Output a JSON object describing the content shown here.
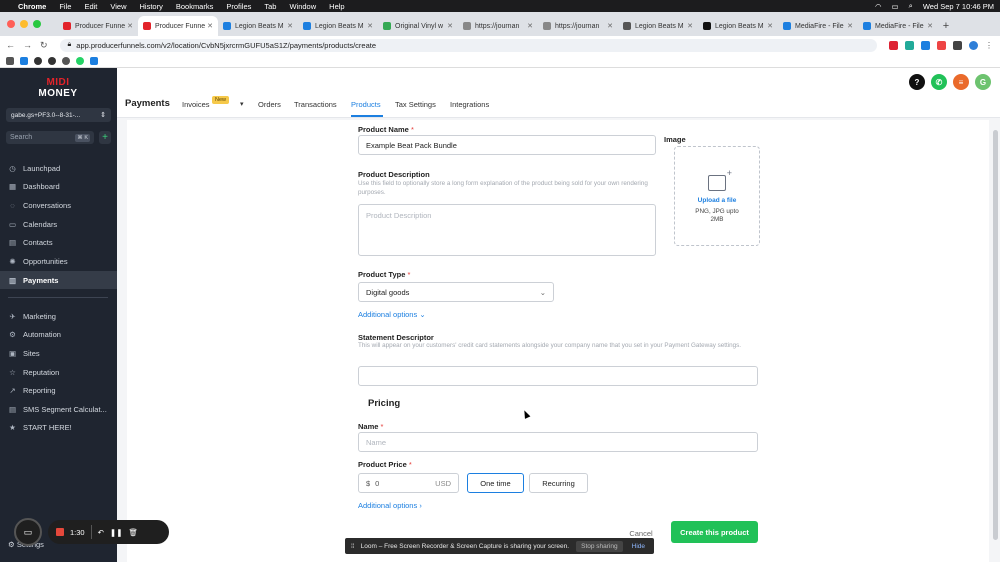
{
  "mac_menubar": {
    "app": "Chrome",
    "menus": [
      "File",
      "Edit",
      "View",
      "History",
      "Bookmarks",
      "Profiles",
      "Tab",
      "Window",
      "Help"
    ],
    "clock": "Wed Sep 7  10:46 PM"
  },
  "browser": {
    "tabs": [
      {
        "label": "Producer Funne",
        "color": "#e2232a"
      },
      {
        "label": "Producer Funne",
        "color": "#e2232a",
        "active": true
      },
      {
        "label": "Legion Beats M",
        "color": "#1c7fe0"
      },
      {
        "label": "Legion Beats M",
        "color": "#1c7fe0"
      },
      {
        "label": "Original Vinyl w",
        "color": "#34a853"
      },
      {
        "label": "https://journan",
        "color": "#888888"
      },
      {
        "label": "https://journan",
        "color": "#888888"
      },
      {
        "label": "Legion Beats M",
        "color": "#555555"
      },
      {
        "label": "Legion Beats M",
        "color": "#111111"
      },
      {
        "label": "MediaFire - File",
        "color": "#1c7fe0"
      },
      {
        "label": "MediaFire - File",
        "color": "#1c7fe0"
      }
    ],
    "url": "app.producerfunnels.com/v2/location/CvbN5jxrcrmGUFU5aS1Z/payments/products/create"
  },
  "sidebar": {
    "logo_line1": "MIDI",
    "logo_line2": "MONEY",
    "account": "gabe.gs+PF3.0--8-31-...",
    "search_placeholder": "Search",
    "search_kbd": "⌘ K",
    "items": [
      {
        "label": "Launchpad",
        "icon": "rocket-icon",
        "glyph": "◷"
      },
      {
        "label": "Dashboard",
        "icon": "dashboard-icon",
        "glyph": "▦"
      },
      {
        "label": "Conversations",
        "icon": "chat-icon",
        "glyph": "◌"
      },
      {
        "label": "Calendars",
        "icon": "calendar-icon",
        "glyph": "▭"
      },
      {
        "label": "Contacts",
        "icon": "contacts-icon",
        "glyph": "▤"
      },
      {
        "label": "Opportunities",
        "icon": "opportunities-icon",
        "glyph": "✺"
      },
      {
        "label": "Payments",
        "icon": "payments-icon",
        "glyph": "▥",
        "active": true
      }
    ],
    "items2": [
      {
        "label": "Marketing",
        "icon": "marketing-icon",
        "glyph": "✈"
      },
      {
        "label": "Automation",
        "icon": "automation-icon",
        "glyph": "⚙"
      },
      {
        "label": "Sites",
        "icon": "sites-icon",
        "glyph": "▣"
      },
      {
        "label": "Reputation",
        "icon": "reputation-icon",
        "glyph": "☆"
      },
      {
        "label": "Reporting",
        "icon": "reporting-icon",
        "glyph": "↗"
      },
      {
        "label": "SMS Segment Calculat...",
        "icon": "sms-icon",
        "glyph": "▤"
      },
      {
        "label": "START HERE!",
        "icon": "star-icon",
        "glyph": "★"
      }
    ],
    "settings": "Settings"
  },
  "header": {
    "title": "Payments",
    "tabs": [
      "Invoices",
      "Orders",
      "Transactions",
      "Products",
      "Tax Settings",
      "Integrations"
    ],
    "new_badge": "New",
    "avatar": "G"
  },
  "form": {
    "product_name_label": "Product Name",
    "product_name_value": "Example Beat Pack Bundle",
    "image_label": "Image",
    "upload_text": "Upload a file",
    "upload_formats": "PNG, JPG upto",
    "upload_size": "2MB",
    "description_label": "Product Description",
    "description_help": "Use this field to optionally store a long form explanation of the product being sold for your own rendering purposes.",
    "description_placeholder": "Product Description",
    "type_label": "Product Type",
    "type_value": "Digital goods",
    "additional_options": "Additional options",
    "statement_label": "Statement Descriptor",
    "statement_help": "This will appear on your customers' credit card statements alongside your company name that you set in your Payment Gateway settings.",
    "pricing_title": "Pricing",
    "name_label": "Name",
    "name_placeholder": "Name",
    "price_label": "Product Price",
    "currency_symbol": "$",
    "price_value": "0",
    "currency": "USD",
    "one_time": "One time",
    "recurring": "Recurring",
    "additional_options_2": "Additional options",
    "cancel": "Cancel",
    "create": "Create this product"
  },
  "recorder": {
    "time": "1:30"
  },
  "loom": {
    "message": "Loom – Free Screen Recorder & Screen Capture is sharing your screen.",
    "stop": "Stop sharing",
    "hide": "Hide"
  },
  "colors": {
    "accent": "#1c7fe0",
    "sidebar": "#1f2530",
    "create_button": "#21c158"
  }
}
